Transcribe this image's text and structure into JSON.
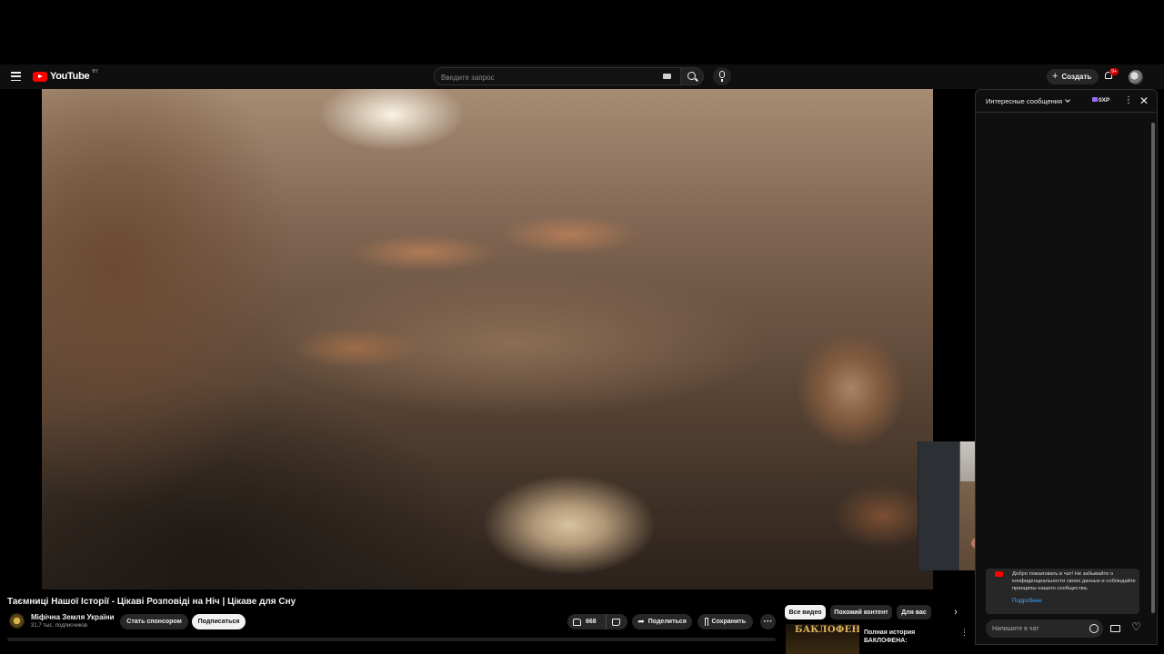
{
  "masthead": {
    "logo_text": "YouTube",
    "country_code": "BY",
    "search_placeholder": "Введите запрос",
    "create_label": "Создать",
    "notification_count": "9+"
  },
  "video": {
    "title": "Таємниці Нашої Історії - Цікаві Розповіді на Ніч | Цікаве для Сну",
    "channel_name": "Міфічна Земля України",
    "subscriber_count": "31,7 тыс. подписчиков",
    "sponsor_label": "Стать спонсором",
    "subscribe_label": "Подписаться",
    "like_count": "668",
    "share_label": "Поделиться",
    "save_label": "Сохранить",
    "more_label": "···"
  },
  "chips": {
    "items": [
      "Все видео",
      "Похожий контент",
      "Для вас"
    ],
    "active_index": 0
  },
  "recommendation": {
    "thumb_text": "БАКЛОФЕН",
    "title": "Полная история БАКЛОФЕНА:"
  },
  "chat": {
    "mode_label": "Интересные сообщения",
    "xp_label": "0XP",
    "notice_text": "Добро пожаловать в чат! Не забывайте о конфиденциальности своих данных и соблюдайте принципы нашего сообщества.",
    "notice_link": "Подробнее",
    "input_placeholder": "Напишите в чат"
  },
  "colors": {
    "background": "#0f0f0f",
    "accent_red": "#ff0000",
    "link_blue": "#3ea6ff",
    "chip_bg": "#272727"
  }
}
